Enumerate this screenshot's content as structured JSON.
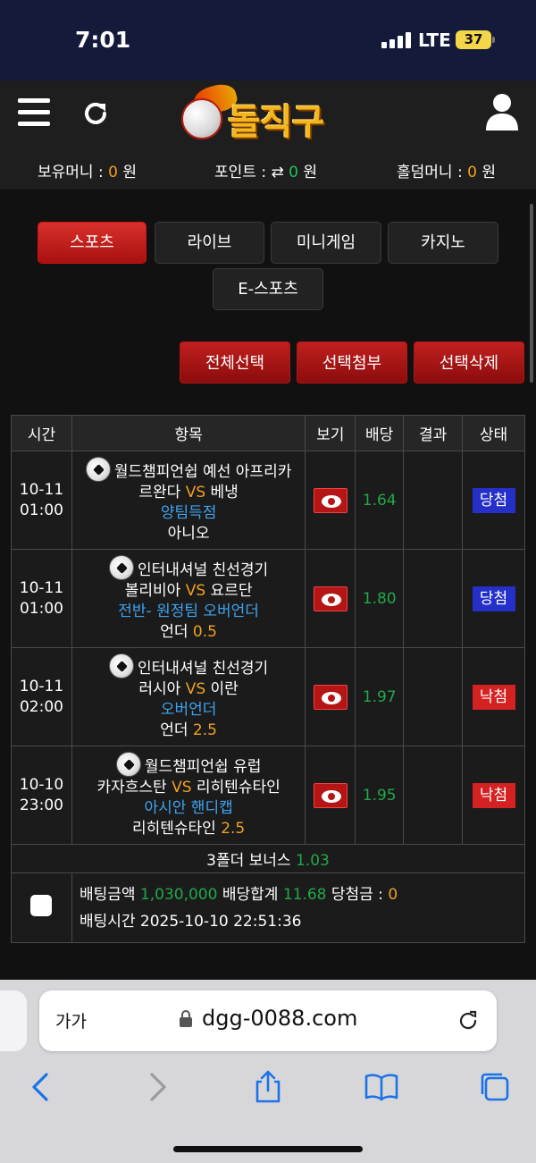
{
  "status_bar": {
    "time": "7:01",
    "network": "LTE",
    "battery": "37"
  },
  "header": {
    "logo_text": "돌직구",
    "balances": [
      {
        "label": "보유머니 : ",
        "value": "0",
        "unit": " 원"
      },
      {
        "label": "포인트 : ",
        "value": "0",
        "unit": " 원"
      },
      {
        "label": "홀덤머니 : ",
        "value": "0",
        "unit": " 원"
      }
    ]
  },
  "tabs": [
    "스포츠",
    "라이브",
    "미니게임",
    "카지노",
    "E-스포츠"
  ],
  "actions": [
    "전체선택",
    "선택첨부",
    "선택삭제"
  ],
  "table": {
    "headers": [
      "시간",
      "항목",
      "보기",
      "배당",
      "결과",
      "상태"
    ],
    "rows": [
      {
        "date": "10-11",
        "time": "01:00",
        "league": "월드챔피언쉽 예선 아프리카",
        "home": "르완다",
        "vs": "VS",
        "away": "베냉",
        "market": "양팀득점",
        "pick": "아니오",
        "pick_value": "",
        "odds": "1.64",
        "result": "",
        "status": "당첨"
      },
      {
        "date": "10-11",
        "time": "01:00",
        "league": "인터내셔널 친선경기",
        "home": "볼리비아",
        "vs": "VS",
        "away": "요르단",
        "market": "전반- 원정팀 오버언더",
        "pick": "언더 ",
        "pick_value": "0.5",
        "odds": "1.80",
        "result": "",
        "status": "당첨"
      },
      {
        "date": "10-11",
        "time": "02:00",
        "league": "인터내셔널 친선경기",
        "home": "러시아",
        "vs": "VS",
        "away": "이란",
        "market": "오버언더",
        "pick": "언더 ",
        "pick_value": "2.5",
        "odds": "1.97",
        "result": "",
        "status": "낙첨"
      },
      {
        "date": "10-10",
        "time": "23:00",
        "league": "월드챔피언쉽 유럽",
        "home": "카자흐스탄",
        "vs": "VS",
        "away": "리히텐슈타인",
        "market": "아시안 핸디캡",
        "pick": "리히텐슈타인 ",
        "pick_value": "2.5",
        "odds": "1.95",
        "result": "",
        "status": "낙첨"
      }
    ],
    "bonus_label": "3폴더 보너스 ",
    "bonus_value": "1.03",
    "summary": {
      "bet_amount_label": "배팅금액 ",
      "bet_amount": "1,030,000",
      "odds_total_label": " 배당합계 ",
      "odds_total": "11.68",
      "win_amount_label": " 당첨금 : ",
      "win_amount": "0",
      "bet_time_label": "배팅시간 ",
      "bet_time": "2025-10-10 22:51:36"
    }
  },
  "browser": {
    "text_size": "가가",
    "url": "dgg-0088.com"
  },
  "colors": {
    "accent_red": "#c0201f",
    "win_blue": "#2530c8",
    "lose_red": "#d42121",
    "odds_green": "#21a84a",
    "highlight_orange": "#f0a020",
    "link_blue": "#3fa4ee"
  }
}
